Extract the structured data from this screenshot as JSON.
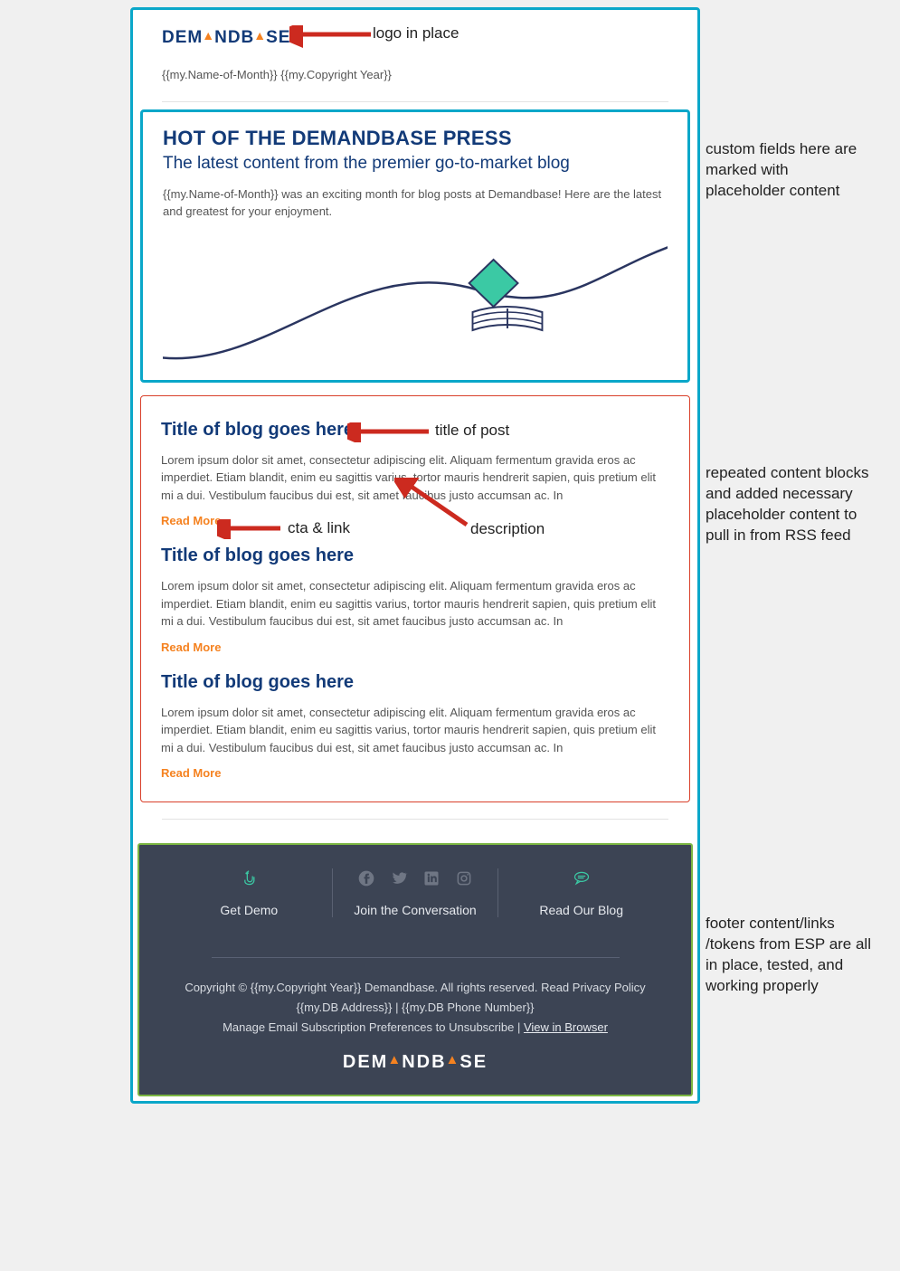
{
  "logo": {
    "text_pre": "DEM",
    "text_mid": "NDB",
    "text_post": "SE"
  },
  "header_line": "{{my.Name-of-Month}} {{my.Copyright Year}}",
  "hero": {
    "title": "HOT OF THE DEMANDBASE PRESS",
    "subtitle": "The latest content from the premier go-to-market blog",
    "body": "{{my.Name-of-Month}} was an exciting month for blog posts at Demandbase! Here are the latest and greatest for your enjoyment."
  },
  "posts": [
    {
      "title": "Title of blog goes here",
      "desc": "Lorem ipsum dolor sit amet, consectetur adipiscing elit. Aliquam fermentum gravida eros ac imperdiet. Etiam blandit, enim eu sagittis varius, tortor mauris hendrerit sapien, quis pretium elit mi a dui. Vestibulum faucibus dui est, sit amet faucibus justo accumsan ac. In",
      "cta": "Read More"
    },
    {
      "title": "Title of blog goes here",
      "desc": "Lorem ipsum dolor sit amet, consectetur adipiscing elit. Aliquam fermentum gravida eros ac imperdiet. Etiam blandit, enim eu sagittis varius, tortor mauris hendrerit sapien, quis pretium elit mi a dui. Vestibulum faucibus dui est, sit amet faucibus justo accumsan ac. In",
      "cta": "Read More"
    },
    {
      "title": "Title of blog goes here",
      "desc": "Lorem ipsum dolor sit amet, consectetur adipiscing elit. Aliquam fermentum gravida eros ac imperdiet. Etiam blandit, enim eu sagittis varius, tortor mauris hendrerit sapien, quis pretium elit mi a dui. Vestibulum faucibus dui est, sit amet faucibus justo accumsan ac. In",
      "cta": "Read More"
    }
  ],
  "footer": {
    "col1_label": "Get Demo",
    "col2_label": "Join the Conversation",
    "col3_label": "Read Our Blog",
    "copyright": "Copyright © {{my.Copyright Year}} Demandbase. All rights reserved. Read Privacy Policy",
    "address": "{{my.DB Address}} | {{my.DB Phone Number}}",
    "manage_pre": "Manage Email Subscription Preferences to Unsubscribe | ",
    "view_browser": "View in Browser"
  },
  "annotations": {
    "a1": "logo in place",
    "a2": "custom fields here are marked with placeholder content",
    "a3": "title of post",
    "a4": "cta & link",
    "a5": "description",
    "a6": "repeated content blocks and added necessary placeholder content to pull in from RSS feed",
    "a7": "footer content/links /tokens from ESP are all in place, tested, and working properly"
  }
}
